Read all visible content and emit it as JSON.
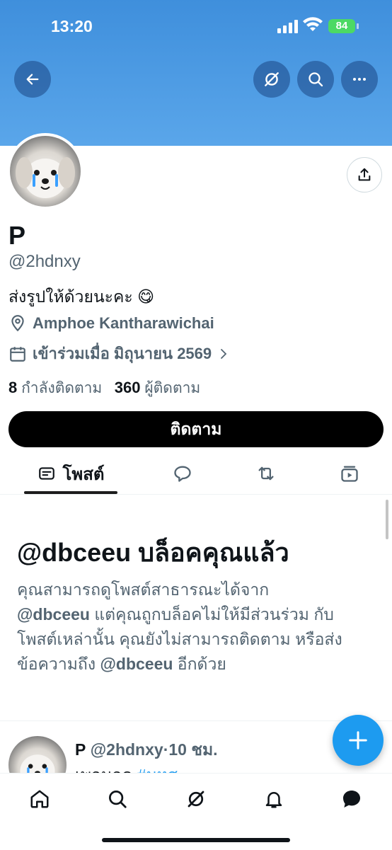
{
  "status_bar": {
    "time": "13:20",
    "battery": "84"
  },
  "header": {
    "back_icon": "arrow-left-icon",
    "grok_icon": "grok-icon",
    "search_icon": "search-icon",
    "more_icon": "more-horizontal-icon",
    "banner_color": "#4a98e2"
  },
  "profile": {
    "name": "P",
    "handle": "@2hdnxy",
    "bio": "ส่งรูปให้ด้วยนะคะ 😋",
    "location": "Amphoe Kantharawichai",
    "joined": "เข้าร่วมเมื่อ มิถุนายน 2569",
    "following_count": "8",
    "following_label": "กำลังติดตาม",
    "followers_count": "360",
    "followers_label": "ผู้ติดตาม",
    "follow_button": "ติดตาม"
  },
  "tabs": [
    {
      "label": "โพสต์",
      "icon": "posts-icon",
      "active": true
    },
    {
      "label": "",
      "icon": "reply-icon"
    },
    {
      "label": "",
      "icon": "repost-icon"
    },
    {
      "label": "",
      "icon": "media-icon"
    }
  ],
  "blocked": {
    "title": "@dbceeu บล็อคคุณแล้ว",
    "text_1": "คุณสามารถดูโพสต์สาธารณะได้จาก",
    "handle_1": "@dbceeu",
    "text_2": " แต่คุณถูกบล็อคไม่ให้มีส่วนร่วม กับโพสต์เหล่านั้น คุณยังไม่สามารถติดตาม หรือส่งข้อความถึง ",
    "handle_2": "@dbceeu",
    "text_3": " อีกด้วย"
  },
  "post": {
    "name": "P",
    "handle": "@2hdnxy",
    "time": "10 ชม.",
    "body_start": "เพอนอด",
    "hashtag": "#มหส"
  },
  "bottom_nav": [
    "home-icon",
    "search-icon",
    "grok-icon",
    "notifications-icon",
    "messages-icon"
  ],
  "colors": {
    "accent": "#1d9bf0",
    "text": "#0f1419",
    "secondary": "#536471"
  }
}
